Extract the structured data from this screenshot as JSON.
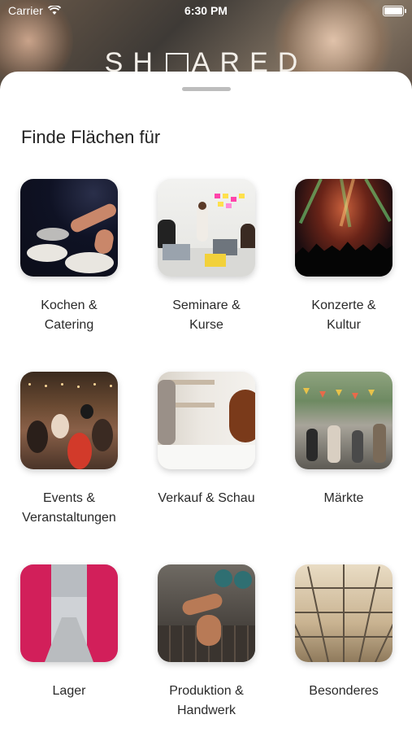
{
  "status_bar": {
    "carrier": "Carrier",
    "time": "6:30 PM"
  },
  "background": {
    "brand": "SHARED"
  },
  "sheet": {
    "title": "Finde Flächen für"
  },
  "categories": [
    {
      "label": "Kochen &\nCatering"
    },
    {
      "label": "Seminare &\nKurse"
    },
    {
      "label": "Konzerte &\nKultur"
    },
    {
      "label": "Events &\nVeranstaltungen"
    },
    {
      "label": "Verkauf & Schau"
    },
    {
      "label": "Märkte"
    },
    {
      "label": "Lager"
    },
    {
      "label": "Produktion &\nHandwerk"
    },
    {
      "label": "Besonderes"
    }
  ],
  "colors": {
    "accent_pink": "#d21f5a",
    "sheet": "#ffffff"
  }
}
